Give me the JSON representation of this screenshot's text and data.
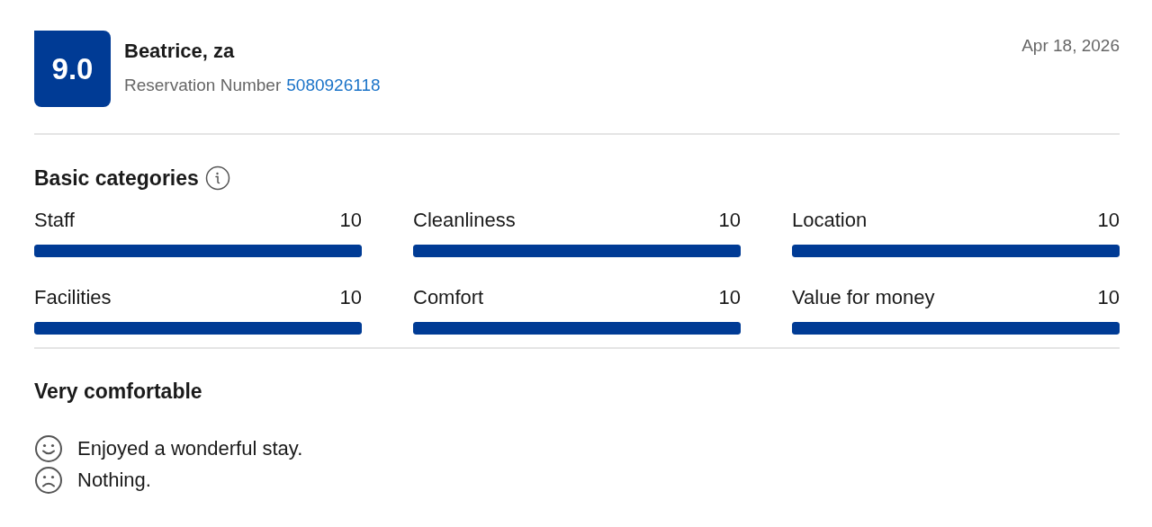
{
  "review": {
    "score": "9.0",
    "reviewer": "Beatrice, za",
    "reservation_label": "Reservation Number",
    "reservation_number": "5080926118",
    "date": "Apr 18, 2026"
  },
  "categories": {
    "title": "Basic categories",
    "items": [
      {
        "name": "Staff",
        "score": "10",
        "level": 1
      },
      {
        "name": "Cleanliness",
        "score": "10",
        "level": 1
      },
      {
        "name": "Location",
        "score": "10",
        "level": 1
      },
      {
        "name": "Facilities",
        "score": "10",
        "level": 1
      },
      {
        "name": "Comfort",
        "score": "10",
        "level": 1
      },
      {
        "name": "Value for money",
        "score": "10",
        "level": 1
      }
    ]
  },
  "comments": {
    "title": "Very comfortable",
    "items": [
      {
        "kind": "positive",
        "text": "Enjoyed a wonderful stay."
      },
      {
        "kind": "negative",
        "text": "Nothing."
      }
    ]
  }
}
